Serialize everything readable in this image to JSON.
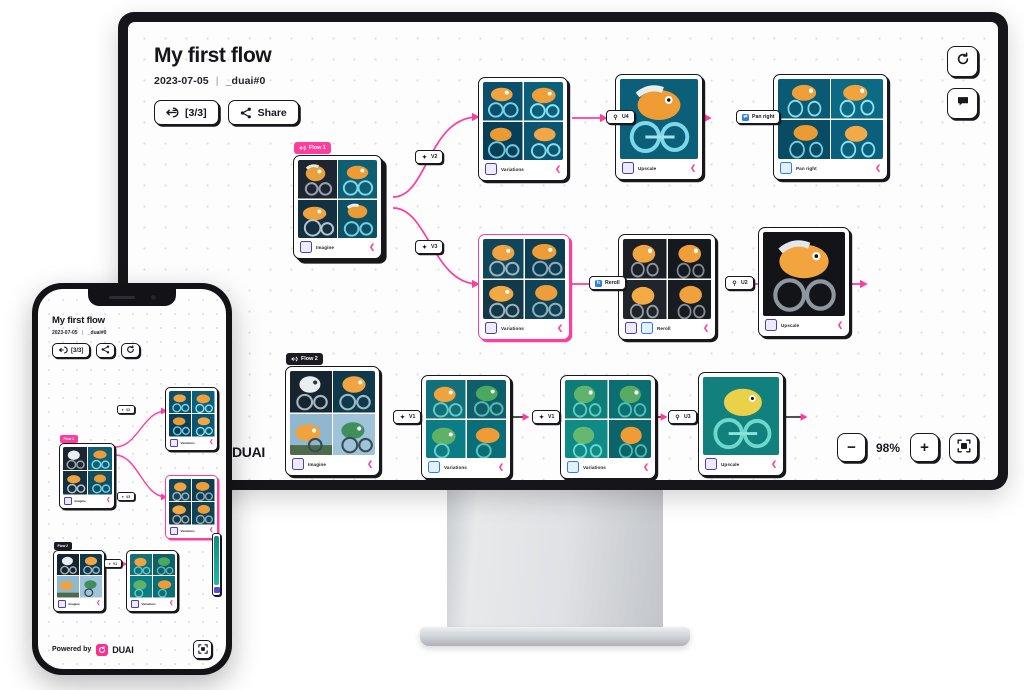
{
  "app": {
    "brand": "DUAI",
    "powered_by": "Powered by"
  },
  "desktop": {
    "title": "My first flow",
    "date": "2023-07-05",
    "separator": "|",
    "handle": "_duai#0",
    "buttons": {
      "credits": "[3/3]",
      "share": "Share"
    },
    "top_right": [
      {
        "name": "refresh-button",
        "icon": "refresh-icon"
      },
      {
        "name": "comment-button",
        "icon": "comment-icon"
      }
    ],
    "zoom": {
      "out": "−",
      "level": "98%",
      "in": "+",
      "fit": "fit-screen-icon"
    }
  },
  "flows": [
    {
      "label": "Flow 1",
      "style": "pink"
    },
    {
      "label": "Flow 2",
      "style": "dark"
    }
  ],
  "nodes": [
    {
      "id": "n-root",
      "label": "Imagine",
      "kind": "grid4",
      "selected": false,
      "stacked": true
    },
    {
      "id": "n-var-top",
      "label": "Variations",
      "kind": "grid4",
      "selected": false,
      "stacked": false
    },
    {
      "id": "n-upscale1",
      "label": "Upscale",
      "kind": "one",
      "selected": false,
      "stacked": false
    },
    {
      "id": "n-panright",
      "label": "Pan right",
      "kind": "grid4",
      "selected": false,
      "stacked": false
    },
    {
      "id": "n-var-mid",
      "label": "Variations",
      "kind": "grid4",
      "selected": true,
      "stacked": false
    },
    {
      "id": "n-reroll",
      "label": "Reroll",
      "kind": "grid4",
      "selected": false,
      "stacked": false
    },
    {
      "id": "n-upscale2",
      "label": "Upscale",
      "kind": "one",
      "selected": false,
      "stacked": false
    },
    {
      "id": "n-root2",
      "label": "Imagine",
      "kind": "grid4",
      "selected": false,
      "stacked": false
    },
    {
      "id": "n-var-b1",
      "label": "Variations",
      "kind": "grid4",
      "selected": false,
      "stacked": false
    },
    {
      "id": "n-var-b2",
      "label": "Variations",
      "kind": "grid4",
      "selected": false,
      "stacked": false
    },
    {
      "id": "n-upscale3",
      "label": "Upscale",
      "kind": "one",
      "selected": false,
      "stacked": false
    }
  ],
  "edge_chips": [
    {
      "id": "c1",
      "icon": "wand-icon",
      "label": "V2"
    },
    {
      "id": "c2",
      "icon": "wand-icon",
      "label": "V3"
    },
    {
      "id": "c3",
      "icon": "magnify-icon",
      "label": "U4"
    },
    {
      "id": "c4",
      "icon": "pan-icon",
      "label": "Pan right"
    },
    {
      "id": "c5",
      "icon": "reroll-icon",
      "label": "Reroll"
    },
    {
      "id": "c6",
      "icon": "magnify-icon",
      "label": "U2"
    },
    {
      "id": "c7",
      "icon": "wand-icon",
      "label": "V1"
    },
    {
      "id": "c8",
      "icon": "wand-icon",
      "label": "V1"
    },
    {
      "id": "c9",
      "icon": "magnify-icon",
      "label": "U3"
    }
  ],
  "phone": {
    "title": "My first flow",
    "date": "2023-07-05",
    "separator": "|",
    "handle": "_duai#0",
    "buttons": {
      "credits": "[3/3]",
      "share": "share-icon",
      "refresh": "refresh-icon"
    },
    "footer": {
      "powered_by": "Powered by",
      "brand": "DUAI",
      "fit": "fit-screen-icon"
    },
    "flows": [
      {
        "label": "Flow 1",
        "style": "pink"
      },
      {
        "label": "Flow 2",
        "style": "dark"
      }
    ],
    "nodes": [
      {
        "id": "p-root",
        "label": "Imagine",
        "selected": false
      },
      {
        "id": "p-v1",
        "label": "Variations",
        "selected": false
      },
      {
        "id": "p-v2",
        "label": "Variations",
        "selected": true
      },
      {
        "id": "p-b1",
        "label": "Imagine",
        "selected": false
      },
      {
        "id": "p-b2",
        "label": "Variations",
        "selected": false
      }
    ],
    "edge_chips": [
      {
        "id": "pc1",
        "label": "V2"
      },
      {
        "id": "pc2",
        "label": "V3"
      },
      {
        "id": "pc3",
        "label": "V1"
      }
    ]
  },
  "watermark": "DUAI",
  "colors": {
    "accent_pink": "#ff3d9a",
    "ink": "#17171c",
    "screen_bg": "#fdfdfd",
    "bezel": "#16161a"
  }
}
